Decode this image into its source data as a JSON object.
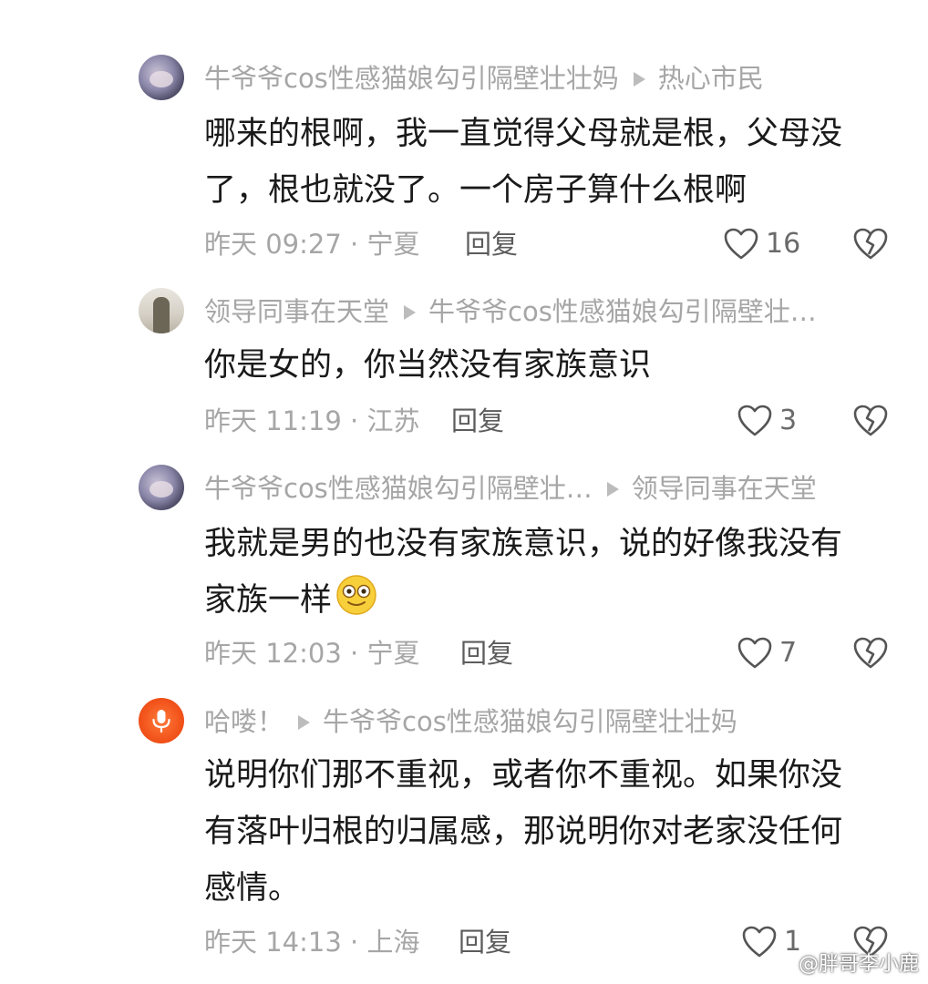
{
  "comments": [
    {
      "author": "牛爷爷cos性感猫娘勾引隔壁壮壮妈",
      "reply_to": "热心市民",
      "avatar": "cat-girl-avatar",
      "text_lines": [
        "哪来的根啊，我一直觉得父母就是根，父母没",
        "了，根也就没了。一个房子算什么根啊"
      ],
      "time_location": "昨天 09:27 · 宁夏",
      "reply_label": "回复",
      "likes": "16"
    },
    {
      "author": "领导同事在天堂",
      "reply_to": "牛爷爷cos性感猫娘勾引隔壁壮…",
      "avatar": "person-avatar",
      "text_lines": [
        "你是女的，你当然没有家族意识"
      ],
      "time_location": "昨天 11:19 · 江苏",
      "reply_label": "回复",
      "likes": "3"
    },
    {
      "author": "牛爷爷cos性感猫娘勾引隔壁壮…",
      "reply_to": "领导同事在天堂",
      "avatar": "cat-girl-avatar",
      "text_lines": [
        "我就是男的也没有家族意识，说的好像我没有",
        "家族一样"
      ],
      "time_location": "昨天 12:03 · 宁夏",
      "reply_label": "回复",
      "likes": "7"
    },
    {
      "author": "哈喽！",
      "reply_to": "牛爷爷cos性感猫娘勾引隔壁壮壮妈",
      "avatar": "microphone-avatar",
      "text_lines": [
        "说明你们那不重视，或者你不重视。如果你没",
        "有落叶归根的归属感，那说明你对老家没任何",
        "感情。"
      ],
      "time_location": "昨天 14:13 · 上海",
      "reply_label": "回复",
      "likes": "1"
    }
  ],
  "watermark": "@胖哥李小鹿",
  "colors": {
    "meta_gray": "#a6a6a6",
    "text": "#1a1a1a",
    "reply": "#5c5c5c",
    "mic_avatar": "#f2541b"
  }
}
